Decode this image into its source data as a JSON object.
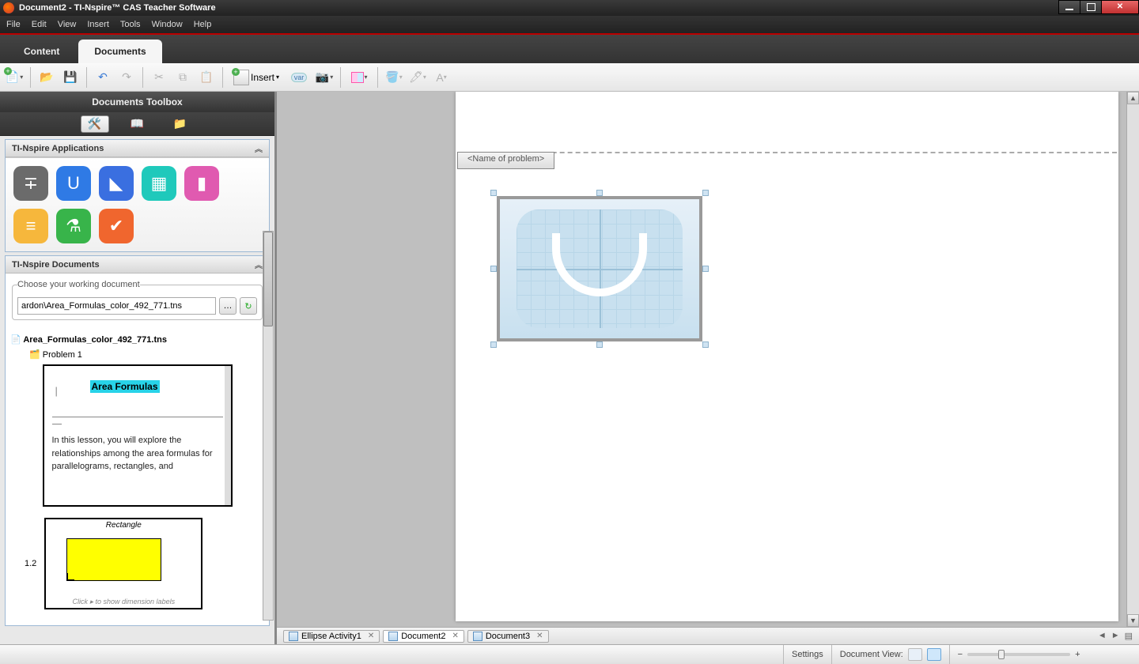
{
  "titlebar": {
    "title": "Document2 - TI-Nspire™ CAS Teacher Software"
  },
  "menubar": [
    "File",
    "Edit",
    "View",
    "Insert",
    "Tools",
    "Window",
    "Help"
  ],
  "workspaceTabs": {
    "content": "Content",
    "documents": "Documents"
  },
  "toolbar": {
    "insert": "Insert"
  },
  "toolbox": {
    "header": "Documents Toolbox",
    "sections": {
      "apps": "TI-Nspire Applications",
      "docs": "TI-Nspire Documents"
    },
    "appIcons": [
      {
        "name": "calculator-icon",
        "glyph": "∓",
        "bg": "#6b6b6b"
      },
      {
        "name": "graphs-icon",
        "glyph": "U",
        "bg": "#2f7ae5"
      },
      {
        "name": "geometry-icon",
        "glyph": "◣",
        "bg": "#3a6fe0"
      },
      {
        "name": "lists-icon",
        "glyph": "▦",
        "bg": "#1fc9bb"
      },
      {
        "name": "data-stats-icon",
        "glyph": "▮",
        "bg": "#e05ab0"
      },
      {
        "name": "notes-icon",
        "glyph": "≡",
        "bg": "#f6b73c"
      },
      {
        "name": "vernier-icon",
        "glyph": "⚗",
        "bg": "#38b44a"
      },
      {
        "name": "question-icon",
        "glyph": "✔",
        "bg": "#f0662e"
      }
    ],
    "chooseLabel": "Choose your working document",
    "path": "ardon\\Area_Formulas_color_492_771.tns",
    "rootDoc": "Area_Formulas_color_492_771.tns",
    "problem": "Problem 1",
    "thumb1": {
      "title": "Area Formulas",
      "desc": "In this lesson, you will explore the relationships among the area formulas for parallelograms, rectangles, and"
    },
    "thumb2": {
      "page": "1.2",
      "label": "Rectangle",
      "caption": "Click ▸ to show dimension labels"
    }
  },
  "canvas": {
    "problemTab": "<Name of problem>"
  },
  "docTabs": [
    {
      "label": "Ellipse Activity1",
      "active": false
    },
    {
      "label": "Document2",
      "active": true
    },
    {
      "label": "Document3",
      "active": false
    }
  ],
  "statusbar": {
    "settings": "Settings",
    "docview": "Document View:"
  }
}
